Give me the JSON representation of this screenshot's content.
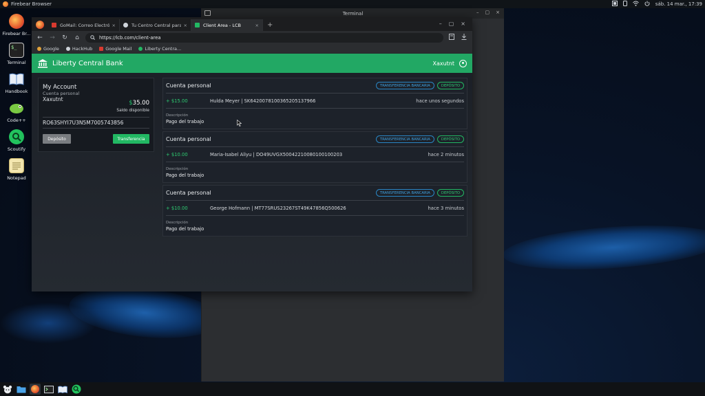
{
  "topbar": {
    "app_name": "Firebear Browser",
    "datetime": "sáb. 14 mar., 17:39"
  },
  "desktop_icons": [
    {
      "label": "Firebear Br...",
      "icon": "firebear-icon"
    },
    {
      "label": "Terminal",
      "icon": "terminal-icon"
    },
    {
      "label": "Handbook",
      "icon": "book-icon"
    },
    {
      "label": "Code++",
      "icon": "code-icon"
    },
    {
      "label": "Scoutify",
      "icon": "scoutify-icon"
    },
    {
      "label": "Notepad",
      "icon": "notepad-icon"
    }
  ],
  "terminal_window": {
    "title": "Terminal"
  },
  "browser": {
    "tabs": [
      {
        "label": "GoMail: Correo Electrón...",
        "active": false,
        "color": "#d93a2f"
      },
      {
        "label": "Tu Centro Central para T...",
        "active": false,
        "color": "#cfd4da"
      },
      {
        "label": "Client Area - LCB",
        "active": true,
        "color": "#22b863"
      }
    ],
    "url": "https://lcb.com/client-area",
    "bookmarks": [
      {
        "label": "Google",
        "color": "#e2a23a"
      },
      {
        "label": "HackHub",
        "color": "#cfd4da"
      },
      {
        "label": "Google Mail",
        "color": "#d93a2f"
      },
      {
        "label": "Liberty Centra...",
        "color": "#22b863"
      }
    ]
  },
  "lcb": {
    "bank_name": "Liberty Central Bank",
    "username": "Xaxutnt",
    "accent_color": "#22a864",
    "account": {
      "title": "My Account",
      "type": "Cuenta personal",
      "holder": "Xaxutnt",
      "currency": "$",
      "balance": "35.00",
      "balance_label": "Saldo disponible",
      "iban": "RO63SHYI7U3N5M7005743856",
      "deposit_label": "Depósito",
      "transfer_label": "Transferencia"
    },
    "transactions": [
      {
        "title": "Cuenta personal",
        "badge_method": "TRANSFERENCIA BANCARIA",
        "badge_type": "DEPÓSITO",
        "amount": "+ $15.00",
        "party": "Hulda Meyer | SK6420078100365205137966",
        "time": "hace unos segundos",
        "desc_label": "Descripción",
        "desc": "Pago del trabajo"
      },
      {
        "title": "Cuenta personal",
        "badge_method": "TRANSFERENCIA BANCARIA",
        "badge_type": "DEPÓSITO",
        "amount": "+ $10.00",
        "party": "Maria-Isabel Aliyu | DO49UVGX50042210080100100203",
        "time": "hace 2 minutos",
        "desc_label": "Descripción",
        "desc": "Pago del trabajo"
      },
      {
        "title": "Cuenta personal",
        "badge_method": "TRANSFERENCIA BANCARIA",
        "badge_type": "DEPÓSITO",
        "amount": "+ $10.00",
        "party": "George Hofmann | MT77SRUS23267ST49K47856Q500626",
        "time": "hace 3 minutos",
        "desc_label": "Descripción",
        "desc": "Pago del trabajo"
      }
    ]
  },
  "taskbar": [
    {
      "icon": "bear-menu-icon"
    },
    {
      "icon": "files-icon"
    },
    {
      "icon": "firebear-icon",
      "active": true
    },
    {
      "icon": "terminal-icon"
    },
    {
      "icon": "book-icon"
    },
    {
      "icon": "scoutify-icon"
    }
  ]
}
